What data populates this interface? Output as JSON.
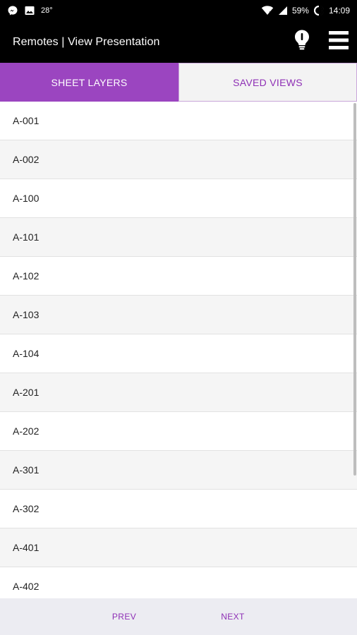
{
  "status_bar": {
    "temperature": "28°",
    "battery": "59%",
    "time": "14:09",
    "icons_left": [
      "messenger-icon",
      "image-icon"
    ],
    "icons_right": [
      "wifi-icon",
      "signal-icon",
      "battery-icon"
    ]
  },
  "app_bar": {
    "title": "Remotes | View Presentation",
    "actions": [
      "lightbulb-icon",
      "menu-icon"
    ]
  },
  "tabs": [
    {
      "label": "SHEET LAYERS",
      "active": true
    },
    {
      "label": "SAVED VIEWS",
      "active": false
    }
  ],
  "sheets": [
    "A-001",
    "A-002",
    "A-100",
    "A-101",
    "A-102",
    "A-103",
    "A-104",
    "A-201",
    "A-202",
    "A-301",
    "A-302",
    "A-401",
    "A-402"
  ],
  "bottom_nav": {
    "prev_label": "PREV",
    "next_label": "NEXT"
  },
  "colors": {
    "accent": "#9b45c0",
    "accent_text": "#8e2fb5",
    "bar": "#000000"
  }
}
